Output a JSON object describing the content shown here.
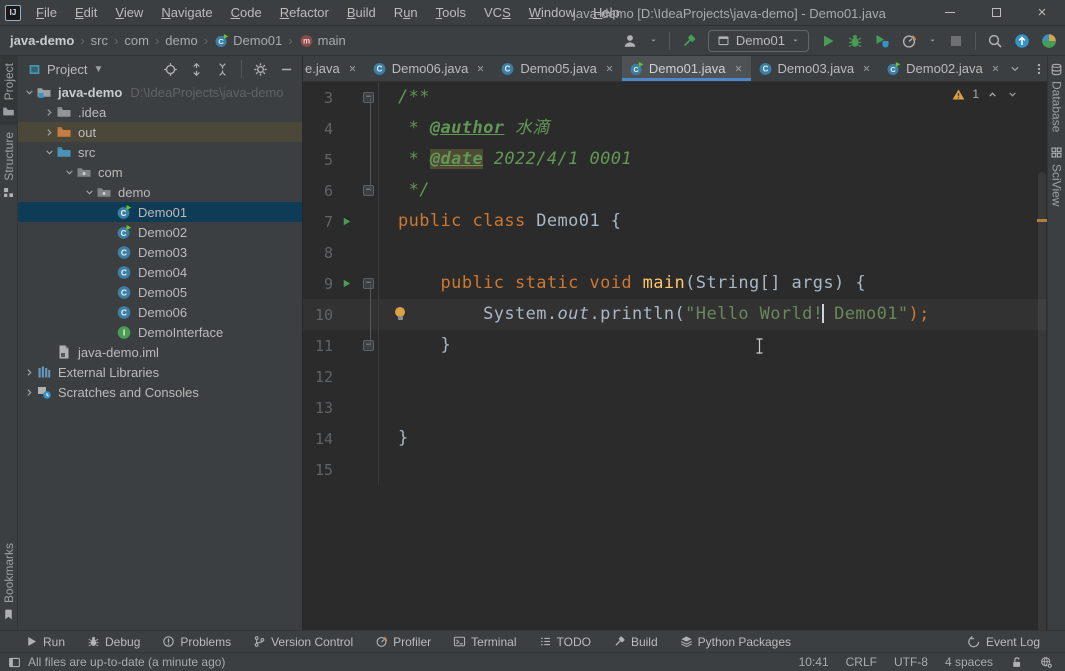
{
  "window": {
    "title": "java-demo [D:\\IdeaProjects\\java-demo] - Demo01.java",
    "menu_items": [
      {
        "label": "File",
        "u": 0
      },
      {
        "label": "Edit",
        "u": 0
      },
      {
        "label": "View",
        "u": 0
      },
      {
        "label": "Navigate",
        "u": 0
      },
      {
        "label": "Code",
        "u": 0
      },
      {
        "label": "Refactor",
        "u": 0
      },
      {
        "label": "Build",
        "u": 0
      },
      {
        "label": "Run",
        "u": 1
      },
      {
        "label": "Tools",
        "u": 0
      },
      {
        "label": "VCS",
        "u": 2
      },
      {
        "label": "Window",
        "u": 0
      },
      {
        "label": "Help",
        "u": 0
      }
    ]
  },
  "navbar": {
    "breadcrumbs": [
      {
        "label": "java-demo",
        "bold": true
      },
      {
        "label": "src"
      },
      {
        "label": "com"
      },
      {
        "label": "demo"
      },
      {
        "label": "Demo01",
        "icon": "class-run"
      },
      {
        "label": "main",
        "icon": "method"
      }
    ],
    "run_config": "Demo01"
  },
  "left_strip": [
    {
      "label": "Project",
      "icon": "folder-plain",
      "active": true
    },
    {
      "label": "Structure",
      "icon": "structure"
    },
    {
      "label": "Bookmarks",
      "icon": "bookmarks",
      "bottom": true
    }
  ],
  "right_strip": [
    {
      "label": "Database",
      "icon": "database"
    },
    {
      "label": "SciView",
      "icon": "grid"
    }
  ],
  "project_panel": {
    "title": "Project",
    "root_path": "D:\\IdeaProjects\\java-demo",
    "tree": [
      {
        "label": "java-demo",
        "path": "D:\\IdeaProjects\\java-demo",
        "icon": "folder-root",
        "chevron": "open",
        "depth": 0,
        "root": true
      },
      {
        "label": ".idea",
        "icon": "folder",
        "chevron": "closed",
        "depth": 1
      },
      {
        "label": "out",
        "icon": "folder-excluded",
        "chevron": "closed",
        "depth": 1,
        "state": "hover"
      },
      {
        "label": "src",
        "icon": "folder-src",
        "chevron": "open",
        "depth": 1
      },
      {
        "label": "com",
        "icon": "package",
        "chevron": "open",
        "depth": 2
      },
      {
        "label": "demo",
        "icon": "package",
        "chevron": "open",
        "depth": 3
      },
      {
        "label": "Demo01",
        "icon": "class-run",
        "depth": 4,
        "state": "selected"
      },
      {
        "label": "Demo02",
        "icon": "class-run",
        "depth": 4
      },
      {
        "label": "Demo03",
        "icon": "class",
        "depth": 4
      },
      {
        "label": "Demo04",
        "icon": "class",
        "depth": 4
      },
      {
        "label": "Demo05",
        "icon": "class",
        "depth": 4
      },
      {
        "label": "Demo06",
        "icon": "class",
        "depth": 4
      },
      {
        "label": "DemoInterface",
        "icon": "interface",
        "depth": 4
      },
      {
        "label": "java-demo.iml",
        "icon": "iml",
        "depth": 1,
        "noChevron": true
      },
      {
        "label": "External Libraries",
        "icon": "libs",
        "chevron": "closed",
        "depth": 0
      },
      {
        "label": "Scratches and Consoles",
        "icon": "scratches",
        "chevron": "closed",
        "depth": 0
      }
    ]
  },
  "tabs": [
    {
      "label": "e.java",
      "clipped": true
    },
    {
      "label": "Demo06.java",
      "icon": "class"
    },
    {
      "label": "Demo05.java",
      "icon": "class"
    },
    {
      "label": "Demo01.java",
      "icon": "class-run",
      "active": true
    },
    {
      "label": "Demo03.java",
      "icon": "class"
    },
    {
      "label": "Demo02.java",
      "icon": "class-run"
    }
  ],
  "editor": {
    "inspection_warnings": "1",
    "lines": [
      {
        "n": 3,
        "fold": "start",
        "tokens": [
          {
            "t": "/**",
            "c": "doc"
          }
        ]
      },
      {
        "n": 4,
        "tokens": [
          {
            "t": " * ",
            "c": "doc"
          },
          {
            "t": "@author",
            "c": "tag"
          },
          {
            "t": " 水滴",
            "c": "docv"
          }
        ]
      },
      {
        "n": 5,
        "tokens": [
          {
            "t": " * ",
            "c": "doc"
          },
          {
            "t": "@date",
            "c": "tag hl"
          },
          {
            "t": " 2022/4/1 0001",
            "c": "docv"
          }
        ]
      },
      {
        "n": 6,
        "fold": "end",
        "tokens": [
          {
            "t": " */",
            "c": "doc"
          }
        ]
      },
      {
        "n": 7,
        "run": true,
        "tokens": [
          {
            "t": "public class ",
            "c": "kw"
          },
          {
            "t": "Demo01 {",
            "c": "p"
          }
        ]
      },
      {
        "n": 8,
        "tokens": []
      },
      {
        "n": 9,
        "run": true,
        "fold": "start",
        "tokens": [
          {
            "t": "    ",
            "c": "p"
          },
          {
            "t": "public static void ",
            "c": "kw"
          },
          {
            "t": "main",
            "c": "m"
          },
          {
            "t": "(String[] args) {",
            "c": "p"
          }
        ]
      },
      {
        "n": 10,
        "bulb": true,
        "current": true,
        "tokens": [
          {
            "t": "        ",
            "c": "p"
          },
          {
            "t": "System.",
            "c": "p"
          },
          {
            "t": "out",
            "c": "f"
          },
          {
            "t": ".println(",
            "c": "p"
          },
          {
            "t": "\"Hello World!",
            "c": "s"
          },
          {
            "c": "caret"
          },
          {
            "t": " Demo01\"",
            "c": "s"
          },
          {
            "t": ");",
            "c": "o"
          }
        ]
      },
      {
        "n": 11,
        "fold": "end",
        "tokens": [
          {
            "t": "    }",
            "c": "p"
          }
        ]
      },
      {
        "n": 12,
        "tokens": []
      },
      {
        "n": 13,
        "tokens": []
      },
      {
        "n": 14,
        "tokens": [
          {
            "t": "}",
            "c": "p"
          }
        ]
      },
      {
        "n": 15,
        "tokens": []
      }
    ]
  },
  "bottom_bar": {
    "left": [
      {
        "label": "Run",
        "icon": "play-gray"
      },
      {
        "label": "Debug",
        "icon": "bug-gray"
      },
      {
        "label": "Problems",
        "icon": "problems"
      },
      {
        "label": "Version Control",
        "icon": "branch"
      },
      {
        "label": "Profiler",
        "icon": "gauge"
      },
      {
        "label": "Terminal",
        "icon": "terminal"
      },
      {
        "label": "TODO",
        "icon": "todo"
      },
      {
        "label": "Build",
        "icon": "hammer-gray"
      },
      {
        "label": "Python Packages",
        "icon": "layers"
      }
    ],
    "right": [
      {
        "label": "Event Log",
        "icon": "event"
      }
    ]
  },
  "status_bar": {
    "message": "All files are up-to-date (a minute ago)",
    "caret_position": "10:41",
    "line_ending": "CRLF",
    "encoding": "UTF-8",
    "indent": "4 spaces"
  },
  "colors": {
    "panel_bg": "#3C3F41",
    "editor_bg": "#2B2B2B",
    "tab_underline": "#4A88C7",
    "selection_bg": "#0E3B55",
    "keyword": "#CC7832",
    "string": "#6A8759",
    "doc_comment": "#629755",
    "warning": "#D9A343",
    "run_green": "#499C54"
  }
}
